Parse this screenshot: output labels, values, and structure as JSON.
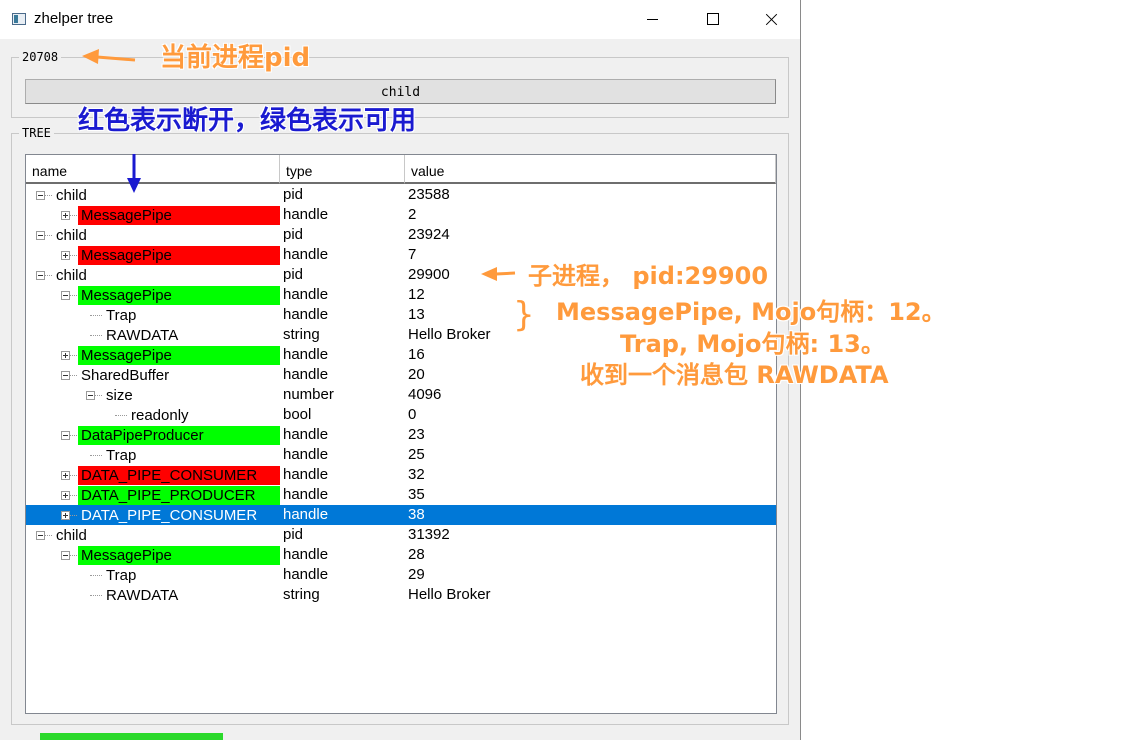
{
  "window": {
    "title": "zhelper tree"
  },
  "pid_group": {
    "legend": "20708",
    "button_label": "child"
  },
  "tree_group": {
    "legend": "TREE",
    "columns": [
      "name",
      "type",
      "value"
    ],
    "rows": [
      {
        "depth": 0,
        "expander": "minus",
        "name": "child",
        "type": "pid",
        "value": "23588",
        "bg": null
      },
      {
        "depth": 1,
        "expander": "plus",
        "name": "MessagePipe",
        "type": "handle",
        "value": "2",
        "bg": "red"
      },
      {
        "depth": 0,
        "expander": "minus",
        "name": "child",
        "type": "pid",
        "value": "23924",
        "bg": null
      },
      {
        "depth": 1,
        "expander": "plus",
        "name": "MessagePipe",
        "type": "handle",
        "value": "7",
        "bg": "red"
      },
      {
        "depth": 0,
        "expander": "minus",
        "name": "child",
        "type": "pid",
        "value": "29900",
        "bg": null
      },
      {
        "depth": 1,
        "expander": "minus",
        "name": "MessagePipe",
        "type": "handle",
        "value": "12",
        "bg": "green"
      },
      {
        "depth": 2,
        "expander": null,
        "name": "Trap",
        "type": "handle",
        "value": "13",
        "bg": null
      },
      {
        "depth": 2,
        "expander": null,
        "name": "RAWDATA",
        "type": "string",
        "value": "Hello Broker",
        "bg": null
      },
      {
        "depth": 1,
        "expander": "plus",
        "name": "MessagePipe",
        "type": "handle",
        "value": "16",
        "bg": "green"
      },
      {
        "depth": 1,
        "expander": "minus",
        "name": "SharedBuffer",
        "type": "handle",
        "value": "20",
        "bg": null
      },
      {
        "depth": 2,
        "expander": "minus",
        "name": "size",
        "type": "number",
        "value": "4096",
        "bg": null
      },
      {
        "depth": 3,
        "expander": null,
        "name": "readonly",
        "type": "bool",
        "value": "0",
        "bg": null
      },
      {
        "depth": 1,
        "expander": "minus",
        "name": "DataPipeProducer",
        "type": "handle",
        "value": "23",
        "bg": "green"
      },
      {
        "depth": 2,
        "expander": null,
        "name": "Trap",
        "type": "handle",
        "value": "25",
        "bg": null
      },
      {
        "depth": 1,
        "expander": "plus",
        "name": "DATA_PIPE_CONSUMER",
        "type": "handle",
        "value": "32",
        "bg": "red"
      },
      {
        "depth": 1,
        "expander": "plus",
        "name": "DATA_PIPE_PRODUCER",
        "type": "handle",
        "value": "35",
        "bg": "green"
      },
      {
        "depth": 1,
        "expander": "plus",
        "name": "DATA_PIPE_CONSUMER",
        "type": "handle",
        "value": "38",
        "bg": "selected",
        "selected": true
      },
      {
        "depth": 0,
        "expander": "minus",
        "name": "child",
        "type": "pid",
        "value": "31392",
        "bg": null
      },
      {
        "depth": 1,
        "expander": "minus",
        "name": "MessagePipe",
        "type": "handle",
        "value": "28",
        "bg": "green"
      },
      {
        "depth": 2,
        "expander": null,
        "name": "Trap",
        "type": "handle",
        "value": "29",
        "bg": null
      },
      {
        "depth": 2,
        "expander": null,
        "name": "RAWDATA",
        "type": "string",
        "value": "Hello Broker",
        "bg": null
      }
    ]
  },
  "annotations": {
    "current_pid": "当前进程pid",
    "color_legend": "红色表示断开，绿色表示可用",
    "child_process": "子进程，  pid:29900",
    "brace": "}",
    "message_pipe": "MessagePipe, Mojo句柄：12。",
    "trap": "Trap, Mojo句柄: 13。",
    "received": "收到一个消息包 RAWDATA"
  },
  "colors": {
    "disconnected": "#ff0000",
    "available": "#00ff00",
    "selected": "#0078d7",
    "annotation_orange": "#ff9a3c",
    "annotation_blue": "#1a1ad0"
  }
}
